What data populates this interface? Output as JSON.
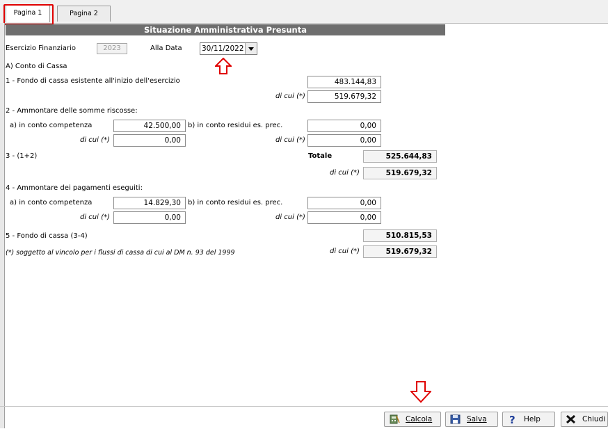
{
  "tabs": [
    {
      "label": "Pagina 1"
    },
    {
      "label": "Pagina 2"
    }
  ],
  "title": "Situazione Amministrativa Presunta",
  "header": {
    "esercizio_label": "Esercizio Finanziario",
    "esercizio_value": "2023",
    "data_label": "Alla Data",
    "data_value": "30/11/2022"
  },
  "section_a": "A) Conto di Cassa",
  "row1": {
    "label": "1 - Fondo di cassa esistente all'inizio dell'esercizio",
    "value": "483.144,83",
    "dicui_label": "di cui (*)",
    "dicui_value": "519.679,32"
  },
  "row2": {
    "label": "2 - Ammontare delle somme riscosse:",
    "a_label": "a) in conto competenza",
    "a_value": "42.500,00",
    "b_label": "b) in conto residui es. prec.",
    "b_value": "0,00",
    "a_dicui_label": "di cui (*)",
    "a_dicui_value": "0,00",
    "b_dicui_label": "di cui (*)",
    "b_dicui_value": "0,00"
  },
  "row3": {
    "label": "3 - (1+2)",
    "totale_label": "Totale",
    "totale_value": "525.644,83",
    "dicui_label": "di cui (*)",
    "dicui_value": "519.679,32"
  },
  "row4": {
    "label": "4 - Ammontare dei pagamenti eseguiti:",
    "a_label": "a) in conto competenza",
    "a_value": "14.829,30",
    "b_label": "b) in conto residui es. prec.",
    "b_value": "0,00",
    "a_dicui_label": "di cui (*)",
    "a_dicui_value": "0,00",
    "b_dicui_label": "di cui (*)",
    "b_dicui_value": "0,00"
  },
  "row5": {
    "label": "5 - Fondo di cassa (3-4)",
    "value": "510.815,53",
    "note": "(*) soggetto al vincolo per i flussi di cassa di cui al DM n. 93 del 1999",
    "dicui_label": "di cui (*)",
    "dicui_value": "519.679,32"
  },
  "buttons": {
    "calcola": "Calcola",
    "salva": "Salva",
    "help": "Help",
    "chiudi": "Chiudi"
  },
  "icons": [
    "calculator-icon",
    "save-icon",
    "help-icon",
    "close-icon",
    "dropdown-arrow-icon",
    "annotation-arrow-icon"
  ],
  "colors": {
    "title_bg": "#6e6e6e",
    "annotation_red": "#e00000"
  }
}
